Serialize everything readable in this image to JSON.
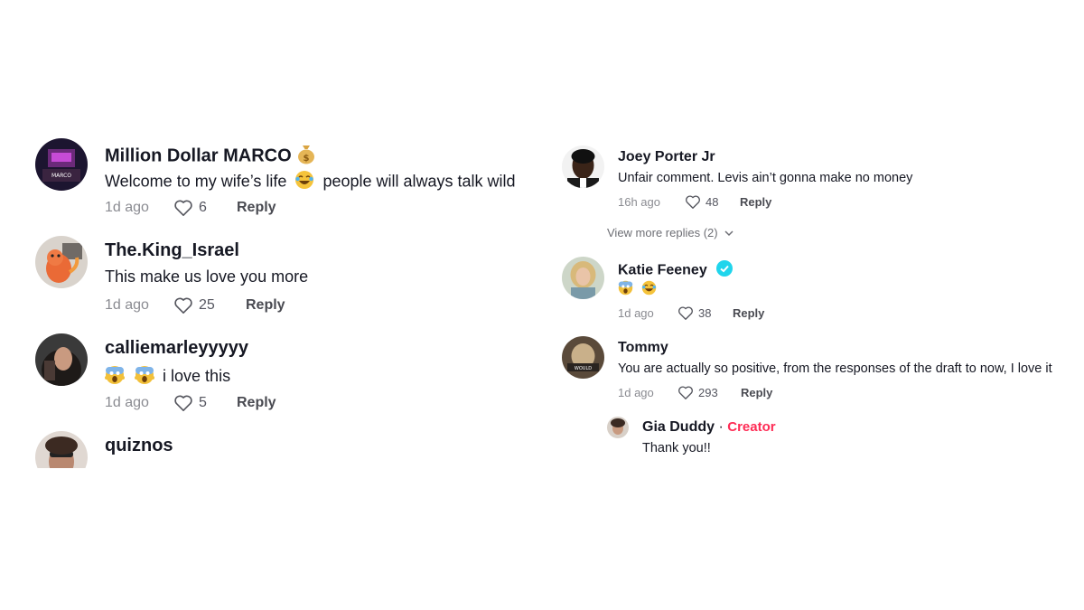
{
  "left_comments": [
    {
      "username": "Million Dollar MARCO",
      "badge_icon": "money-bag-emoji",
      "text_before": "Welcome to my wife’s life",
      "text_emoji": "laughing-tears-emoji",
      "text_after": "people will always talk wild",
      "ago": "1d ago",
      "likes": "6",
      "reply": "Reply"
    },
    {
      "username": "The.King_Israel",
      "text_before": "This make us love you more",
      "ago": "1d ago",
      "likes": "25",
      "reply": "Reply"
    },
    {
      "username": "calliemarleyyyyy",
      "text_emoji": "screaming-face-emoji x2",
      "text_after": "i love this",
      "ago": "1d ago",
      "likes": "5",
      "reply": "Reply"
    },
    {
      "username": "quiznos"
    }
  ],
  "right_comments": [
    {
      "username": "Joey  Porter Jr",
      "text": "Unfair comment. Levis ain’t gonna make no money",
      "ago": "16h ago",
      "likes": "48",
      "reply": "Reply"
    },
    {
      "username": "Katie Feeney",
      "verified": true,
      "text_emojis": "screaming-face-emoji, laughing-tears-emoji",
      "ago": "1d ago",
      "likes": "38",
      "reply": "Reply"
    },
    {
      "username": "Tommy",
      "text": "You are actually so positive, from the responses of the draft to now, I love it",
      "ago": "1d ago",
      "likes": "293",
      "reply": "Reply"
    }
  ],
  "view_more": "View more replies (2)",
  "creator_reply": {
    "username": "Gia Duddy",
    "separator": "·",
    "label": "Creator",
    "text": "Thank you!!"
  },
  "colors": {
    "creator": "#fe2c55",
    "verified": "#20d5ec",
    "meta": "#8a8b91"
  }
}
